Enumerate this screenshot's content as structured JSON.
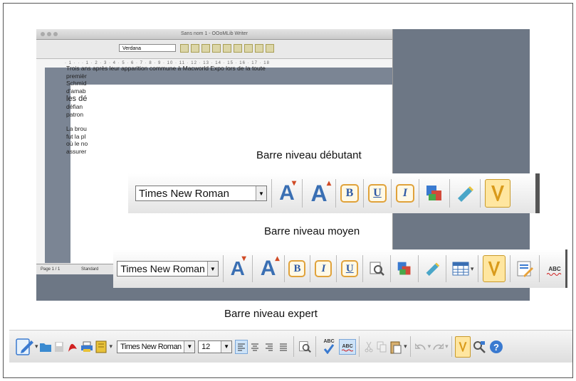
{
  "app": {
    "window_title": "Sans nom 1 - OOoMLib Writer",
    "mini_font": "Verdana",
    "ruler": "· 1 · · · 1 · 2 · 3 · 4 · 5 · 6 · 7 · 8 · 9 · 10 · 11 · 12 · 13 · 14 · 15 · 16 · 17 · 18",
    "status_left": "Page 1 / 1",
    "status_style": "Standard",
    "doc_lines": [
      "Trois ans après leur apparition commune à Macworld Expo lors de la toute",
      "premièr",
      "Schmid",
      "d'amab",
      "les dé",
      "défian",
      "patron ",
      "",
      "La brou",
      "fut la pl",
      "où le no",
      "assurer"
    ]
  },
  "labels": {
    "debutant": "Barre niveau débutant",
    "moyen": "Barre niveau moyen",
    "expert": "Barre niveau expert"
  },
  "toolbar_debutant": {
    "font": "Times New Roman",
    "bold": "B",
    "underline": "U",
    "italic": "I"
  },
  "toolbar_moyen": {
    "font": "Times New Roman",
    "bold": "B",
    "italic": "I",
    "underline": "U",
    "spell": "ABC"
  },
  "toolbar_expert": {
    "font": "Times New Roman",
    "size": "12",
    "spell": "ABC",
    "spell2": "ABC"
  }
}
